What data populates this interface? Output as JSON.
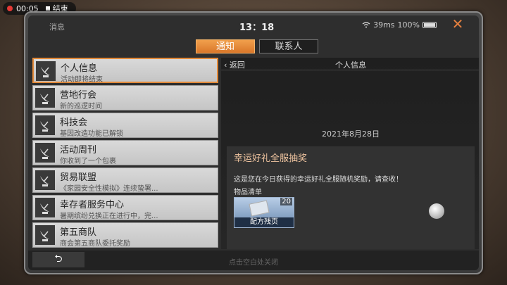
{
  "recording": {
    "time": "00:05",
    "stop_label": "结束"
  },
  "status": {
    "left_label": "消息",
    "time": "13：18",
    "latency": "39ms",
    "battery": "100%"
  },
  "tabs": [
    {
      "label": "通知",
      "active": true
    },
    {
      "label": "联系人",
      "active": false
    }
  ],
  "messages": [
    {
      "title": "个人信息",
      "subtitle": "活动即将结束",
      "selected": true
    },
    {
      "title": "营地行会",
      "subtitle": "新的巡逻时间"
    },
    {
      "title": "科技会",
      "subtitle": "基因改造功能已解锁"
    },
    {
      "title": "活动周刊",
      "subtitle": "你收到了一个包裹"
    },
    {
      "title": "贸易联盟",
      "subtitle": "《家园安全性模拟》连续蛰署..."
    },
    {
      "title": "幸存者服务中心",
      "subtitle": "暑期缤纷兑换正在进行中，完..."
    },
    {
      "title": "第五商队",
      "subtitle": "商会第五商队委托奖励"
    }
  ],
  "detail": {
    "back_label": "返回",
    "title": "个人信息",
    "date": "2021年8月28日",
    "card_title": "幸运好礼全服抽奖",
    "body": "这是您在今日获得的幸运好礼全服随机奖励，请查收！",
    "items_label": "物品清单",
    "reward": {
      "name": "配方残页",
      "qty": "20"
    }
  },
  "footer": {
    "hint": "点击空白处关闭"
  },
  "colors": {
    "accent": "#e28a3a",
    "tab_active": "#e5843a",
    "close": "#e5803f"
  }
}
